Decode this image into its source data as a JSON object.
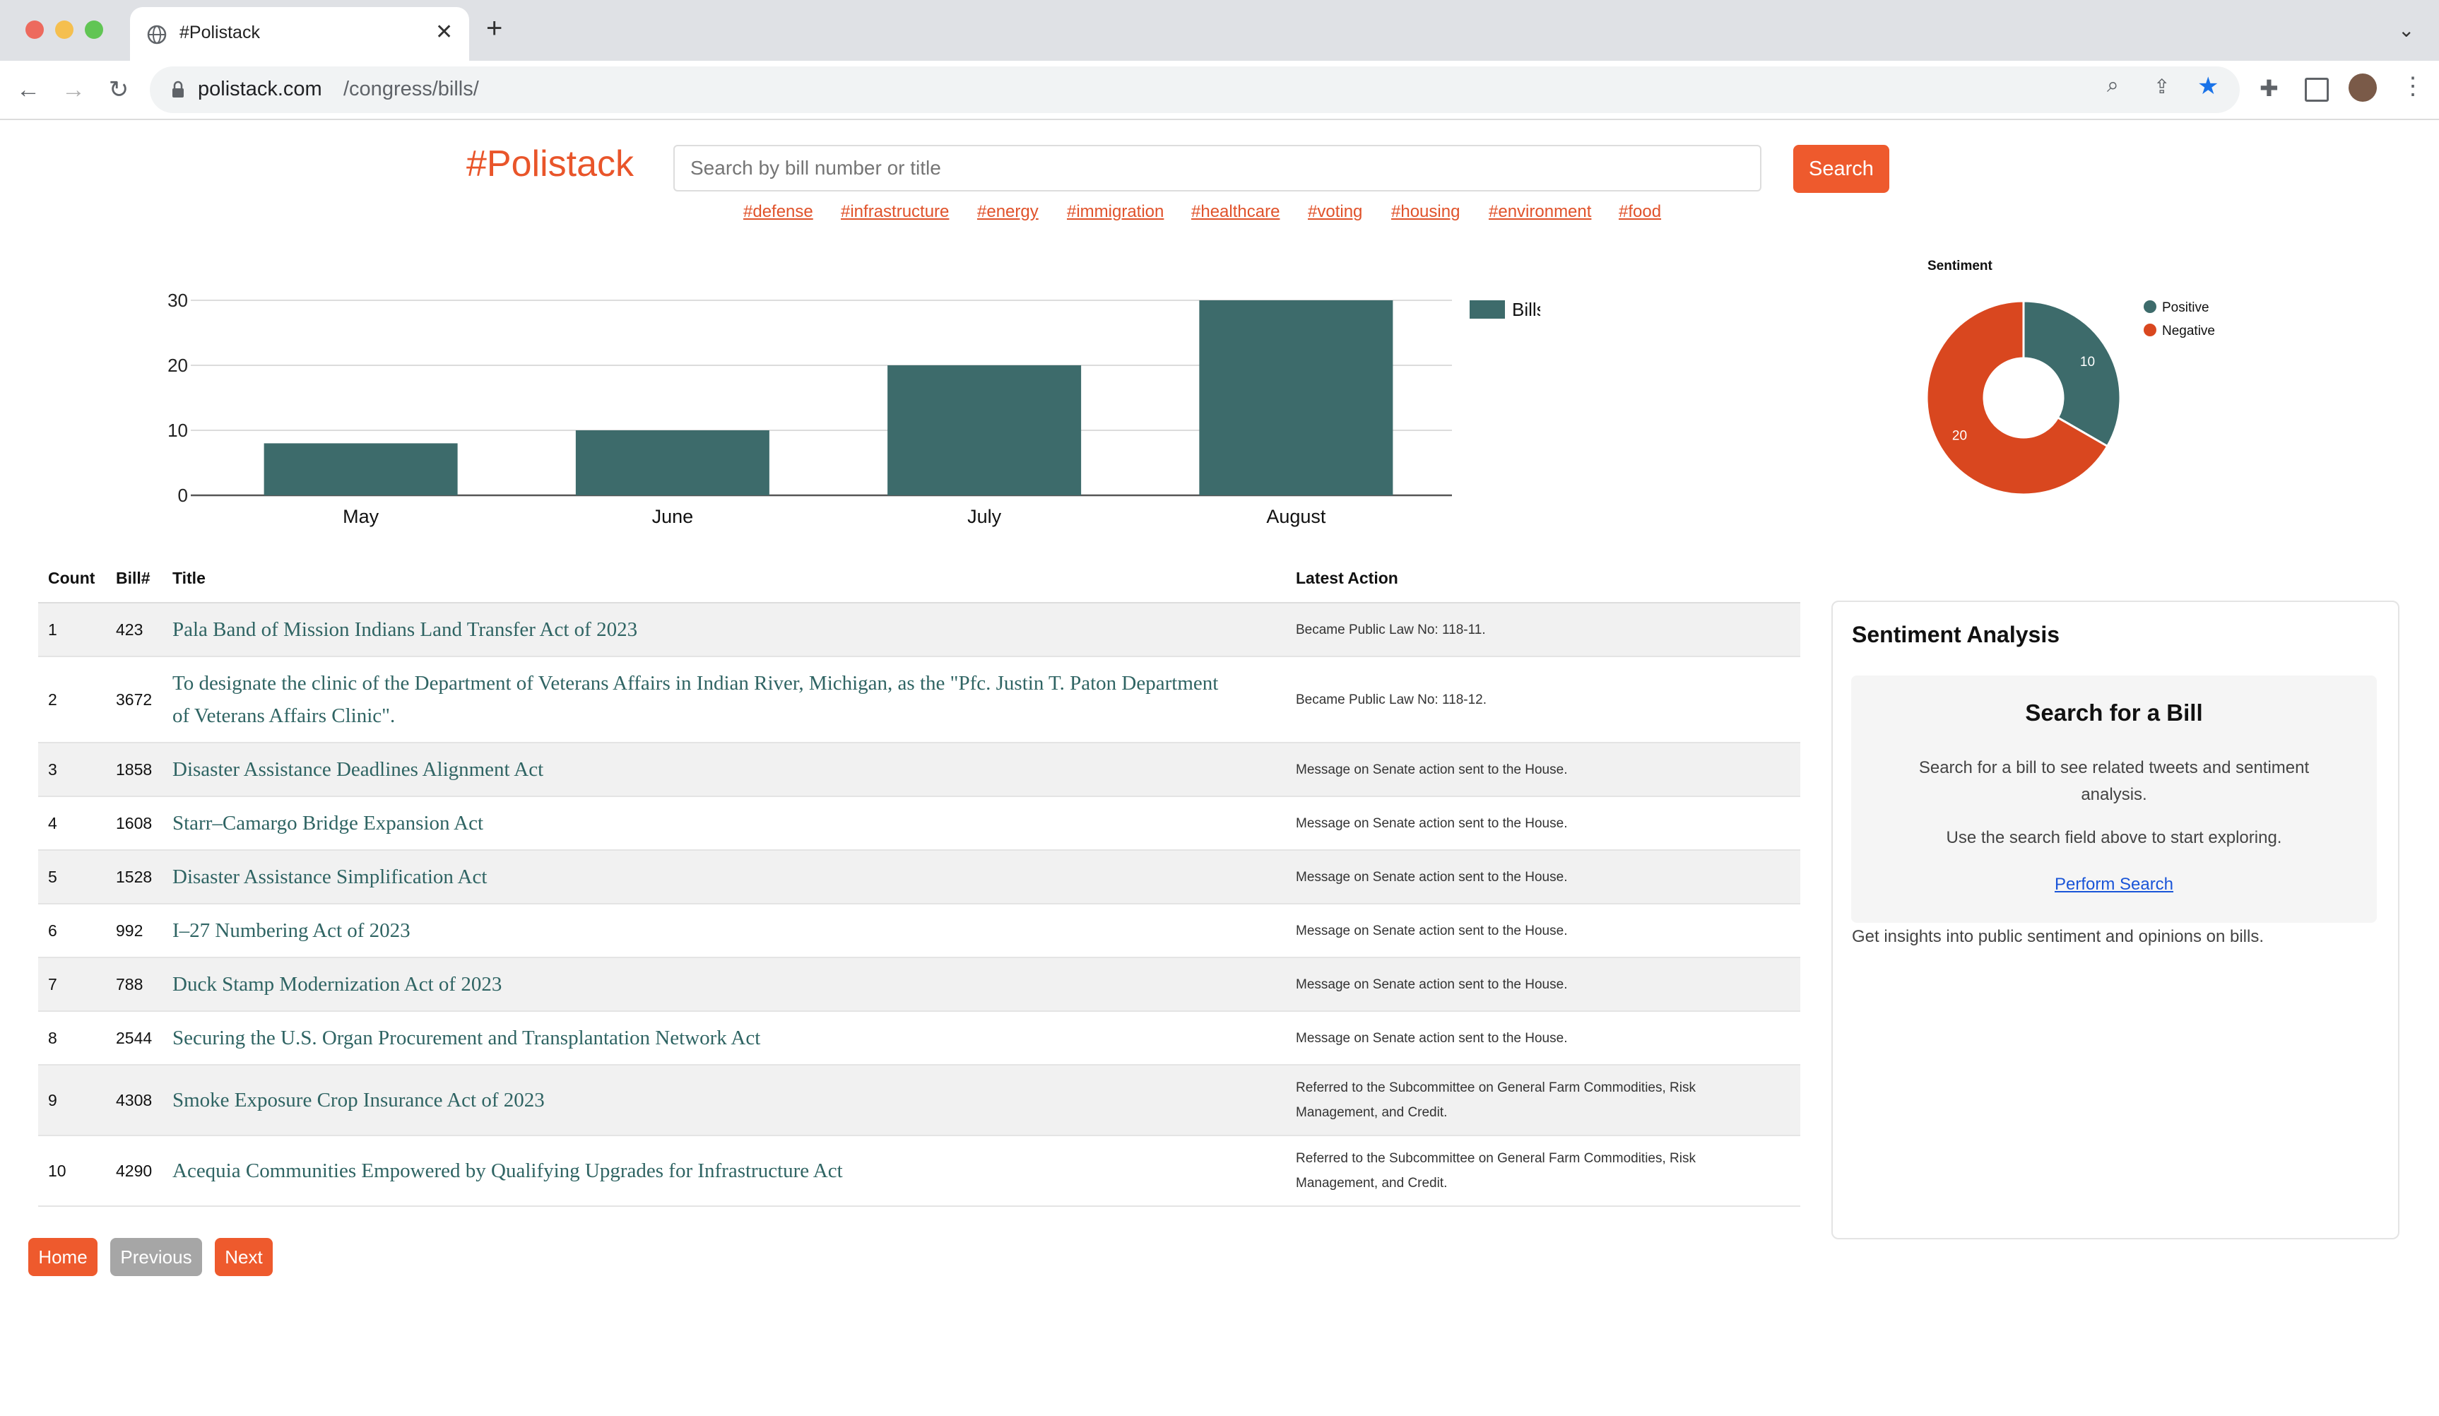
{
  "browser": {
    "tab_title": "#Polistack",
    "url_domain": "polistack.com",
    "url_path": "/congress/bills/",
    "colors": {
      "close": "#ed6a5e",
      "minimize": "#f5bf4f",
      "zoom": "#61c554"
    }
  },
  "header": {
    "logo": "#Polistack",
    "search_placeholder": "Search by bill number or title",
    "search_button": "Search",
    "tags": [
      "#defense",
      "#infrastructure",
      "#energy",
      "#immigration",
      "#healthcare",
      "#voting",
      "#housing",
      "#environment",
      "#food"
    ]
  },
  "chart_data": [
    {
      "type": "bar",
      "categories": [
        "May",
        "June",
        "July",
        "August"
      ],
      "series": [
        {
          "name": "Bills",
          "values": [
            8,
            10,
            20,
            30
          ]
        }
      ],
      "ylim": [
        0,
        30
      ],
      "yticks": [
        0,
        10,
        20,
        30
      ],
      "grid": true,
      "legend": "top-right",
      "color": "#3d6b6b"
    },
    {
      "type": "pie",
      "title": "Sentiment",
      "donut": true,
      "labels": [
        "Positive",
        "Negative"
      ],
      "values": [
        10,
        20
      ],
      "colors": [
        "#3d6b6b",
        "#d9471f"
      ],
      "legend": "right"
    }
  ],
  "table": {
    "headers": {
      "count": "Count",
      "bill": "Bill#",
      "title": "Title",
      "action": "Latest Action"
    },
    "rows": [
      {
        "count": "1",
        "bill": "423",
        "title": "Pala Band of Mission Indians Land Transfer Act of 2023",
        "action": "Became Public Law No: 118-11."
      },
      {
        "count": "2",
        "bill": "3672",
        "title": "To designate the clinic of the Department of Veterans Affairs in Indian River, Michigan, as the \"Pfc. Justin T. Paton Department of Veterans Affairs Clinic\".",
        "action": "Became Public Law No: 118-12."
      },
      {
        "count": "3",
        "bill": "1858",
        "title": "Disaster Assistance Deadlines Alignment Act",
        "action": "Message on Senate action sent to the House."
      },
      {
        "count": "4",
        "bill": "1608",
        "title": "Starr–Camargo Bridge Expansion Act",
        "action": "Message on Senate action sent to the House."
      },
      {
        "count": "5",
        "bill": "1528",
        "title": "Disaster Assistance Simplification Act",
        "action": "Message on Senate action sent to the House."
      },
      {
        "count": "6",
        "bill": "992",
        "title": "I–27 Numbering Act of 2023",
        "action": "Message on Senate action sent to the House."
      },
      {
        "count": "7",
        "bill": "788",
        "title": "Duck Stamp Modernization Act of 2023",
        "action": "Message on Senate action sent to the House."
      },
      {
        "count": "8",
        "bill": "2544",
        "title": "Securing the U.S. Organ Procurement and Transplantation Network Act",
        "action": "Message on Senate action sent to the House."
      },
      {
        "count": "9",
        "bill": "4308",
        "title": "Smoke Exposure Crop Insurance Act of 2023",
        "action": "Referred to the Subcommittee on General Farm Commodities, Risk Management, and Credit."
      },
      {
        "count": "10",
        "bill": "4290",
        "title": "Acequia Communities Empowered by Qualifying Upgrades for Infrastructure Act",
        "action": "Referred to the Subcommittee on General Farm Commodities, Risk Management, and Credit."
      }
    ]
  },
  "pagination": {
    "home": "Home",
    "previous": "Previous",
    "next": "Next"
  },
  "sentiment_panel": {
    "title": "Sentiment Analysis",
    "box_title": "Search for a Bill",
    "box_text1": "Search for a bill to see related tweets and sentiment analysis.",
    "box_text2": "Use the search field above to start exploring.",
    "box_link": "Perform Search",
    "footer": "Get insights into public sentiment and opinions on bills."
  }
}
